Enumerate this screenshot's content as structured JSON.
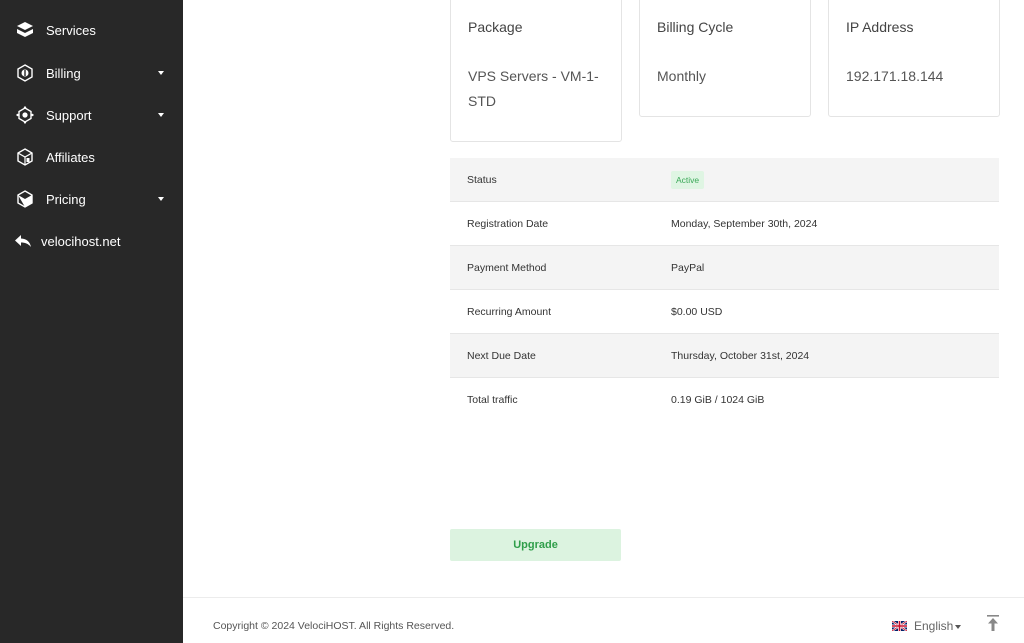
{
  "sidebar": {
    "items": [
      {
        "label": "Services",
        "icon": "services-cube-icon",
        "has_dropdown": false
      },
      {
        "label": "Billing",
        "icon": "billing-cube-icon",
        "has_dropdown": true
      },
      {
        "label": "Support",
        "icon": "support-cube-icon",
        "has_dropdown": true
      },
      {
        "label": "Affiliates",
        "icon": "affiliates-cube-icon",
        "has_dropdown": false
      },
      {
        "label": "Pricing",
        "icon": "pricing-cube-icon",
        "has_dropdown": true
      }
    ],
    "back_link": {
      "label": "velocihost.net",
      "icon": "reply-arrow-icon"
    }
  },
  "cards": [
    {
      "title": "Package",
      "value": "VPS Servers - VM-1-STD"
    },
    {
      "title": "Billing Cycle",
      "value": "Monthly"
    },
    {
      "title": "IP Address",
      "value": "192.171.18.144"
    }
  ],
  "details": {
    "status": {
      "label": "Status",
      "value": "Active"
    },
    "rows": [
      {
        "label": "Registration Date",
        "value": "Monday, September 30th, 2024"
      },
      {
        "label": "Payment Method",
        "value": "PayPal"
      },
      {
        "label": "Recurring Amount",
        "value": "$0.00 USD"
      },
      {
        "label": "Next Due Date",
        "value": "Thursday, October 31st, 2024"
      },
      {
        "label": "Total traffic",
        "value": "0.19 GiB / 1024 GiB"
      }
    ]
  },
  "actions": {
    "upgrade_label": "Upgrade"
  },
  "footer": {
    "copyright": "Copyright © 2024 VelociHOST. All Rights Reserved.",
    "language": "English",
    "language_flag_icon": "uk-flag-icon",
    "scroll_top_icon": "scroll-to-top-icon"
  },
  "colors": {
    "sidebar_bg": "#282828",
    "status_active_bg": "#dff5e3",
    "status_active_text": "#3aa857",
    "upgrade_bg": "#dcf3e0",
    "upgrade_text": "#2f9e4a"
  }
}
